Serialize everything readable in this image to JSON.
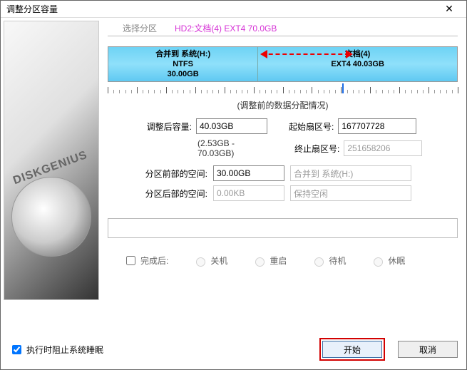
{
  "window_title": "调整分区容量",
  "tabs": {
    "select_label": "选择分区",
    "active_label": "HD2:文档(4) EXT4 70.0GB"
  },
  "partitions": {
    "left": {
      "title": "合并到 系统(H:)",
      "fs": "NTFS",
      "size": "30.00GB"
    },
    "right": {
      "title": "文档(4)",
      "fs_size": "EXT4 40.03GB"
    }
  },
  "section_label": "(调整前的数据分配情况)",
  "fields": {
    "after_size_label": "调整后容量:",
    "after_size_value": "40.03GB",
    "range_hint": "(2.53GB - 70.03GB)",
    "start_sector_label": "起始扇区号:",
    "start_sector_value": "167707728",
    "end_sector_label": "终止扇区号:",
    "end_sector_value": "251658206",
    "space_before_label": "分区前部的空间:",
    "space_before_value": "30.00GB",
    "space_before_target": "合并到 系统(H:)",
    "space_after_label": "分区后部的空间:",
    "space_after_value": "0.00KB",
    "space_after_target": "保持空闲"
  },
  "after_done": {
    "label": "完成后:",
    "opt_shutdown": "关机",
    "opt_restart": "重启",
    "opt_standby": "待机",
    "opt_hibernate": "休眠"
  },
  "prevent_sleep_label": "执行时阻止系统睡眠",
  "buttons": {
    "start": "开始",
    "cancel": "取消"
  },
  "brand": "DISKGENIUS"
}
